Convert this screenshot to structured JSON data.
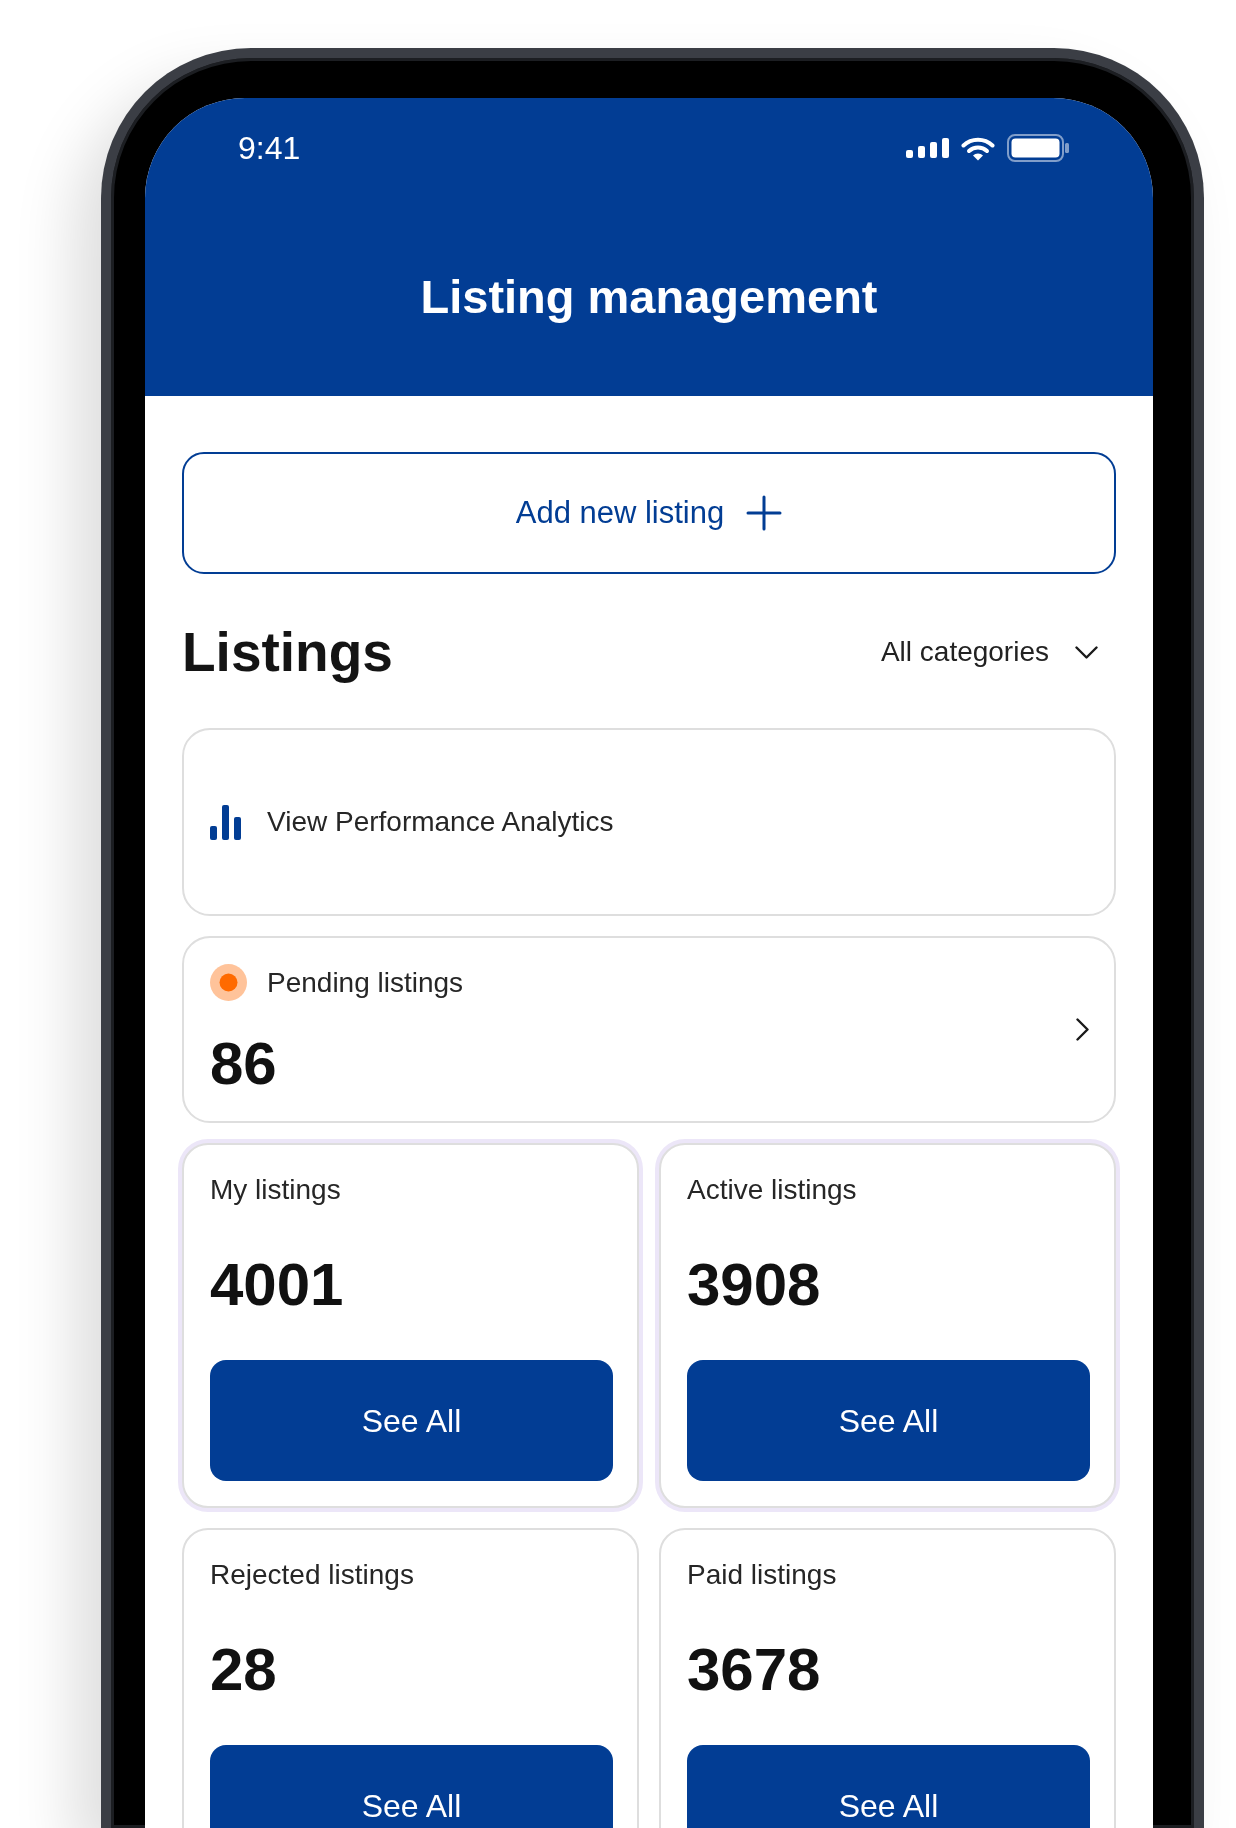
{
  "status_bar": {
    "time": "9:41"
  },
  "header": {
    "title": "Listing management"
  },
  "add_button": {
    "label": "Add new listing"
  },
  "listings": {
    "title": "Listings",
    "filter": {
      "label": "All categories"
    }
  },
  "analytics_card": {
    "label": "View Performance Analytics"
  },
  "pending_card": {
    "label": "Pending listings",
    "count": "86"
  },
  "stat_cards": [
    {
      "label": "My listings",
      "count": "4001",
      "button": "See All",
      "highlighted": true
    },
    {
      "label": "Active listings",
      "count": "3908",
      "button": "See All",
      "highlighted": true
    },
    {
      "label": "Rejected listings",
      "count": "28",
      "button": "See All",
      "highlighted": false
    },
    {
      "label": "Paid listings",
      "count": "3678",
      "button": "See All",
      "highlighted": false
    }
  ]
}
